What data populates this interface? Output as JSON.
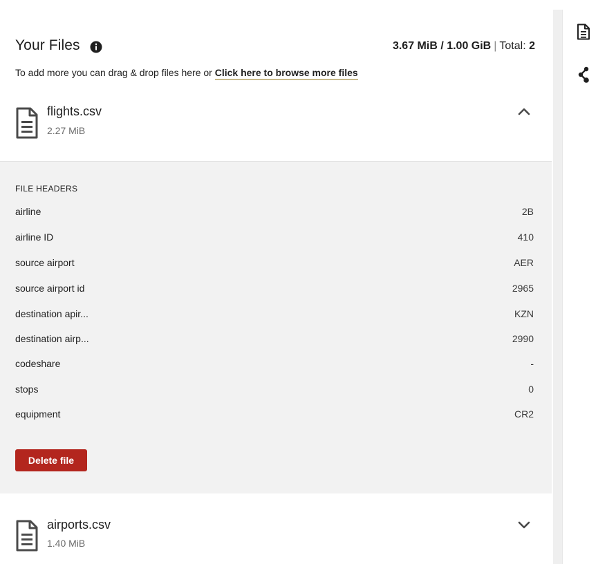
{
  "header": {
    "title": "Your Files",
    "usage_used": "3.67 MiB / 1.00 GiB",
    "usage_separator": "|",
    "total_label": "Total:",
    "total_count": "2"
  },
  "hint": {
    "text": "To add more you can drag & drop files here or ",
    "link": "Click here to browse more files"
  },
  "files": [
    {
      "name": "flights.csv",
      "size": "2.27 MiB",
      "expanded": true,
      "headers_title": "FILE HEADERS",
      "headers": [
        {
          "key": "airline",
          "value": "2B"
        },
        {
          "key": "airline ID",
          "value": "410"
        },
        {
          "key": "source airport",
          "value": "AER"
        },
        {
          "key": "source airport id",
          "value": "2965"
        },
        {
          "key": "destination apir...",
          "value": "KZN"
        },
        {
          "key": "destination airp...",
          "value": "2990"
        },
        {
          "key": "codeshare",
          "value": "-"
        },
        {
          "key": "stops",
          "value": "0"
        },
        {
          "key": "equipment",
          "value": "CR2"
        }
      ],
      "delete_label": "Delete file"
    },
    {
      "name": "airports.csv",
      "size": "1.40 MiB",
      "expanded": false
    }
  ],
  "rail": {
    "items": [
      {
        "icon": "document-icon"
      },
      {
        "icon": "share-graph-icon"
      }
    ]
  },
  "colors": {
    "danger": "#b3261e",
    "panel_bg": "#f2f2f2",
    "link_underline": "#c7b98a"
  }
}
